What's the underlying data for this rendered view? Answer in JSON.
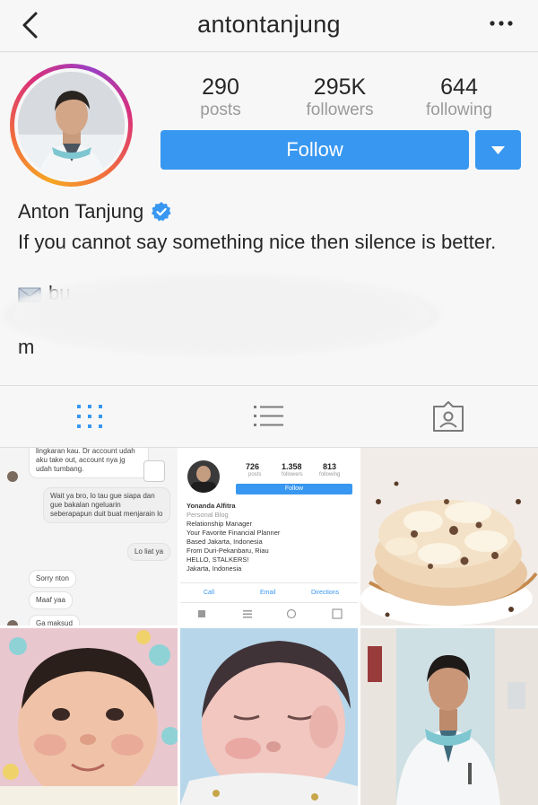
{
  "header": {
    "username": "antontanjung",
    "back_icon": "chevron-left-icon",
    "more_icon": "more-horizontal-icon"
  },
  "profile": {
    "stats": [
      {
        "value": "290",
        "label": "posts"
      },
      {
        "value": "295K",
        "label": "followers"
      },
      {
        "value": "644",
        "label": "following"
      }
    ],
    "follow_label": "Follow",
    "name": "Anton Tanjung",
    "verified_icon": "verified-badge-icon",
    "bio": "If you cannot say something nice then silence is better.",
    "bio_fragment_1": "bu",
    "bio_fragment_2": "m",
    "accent_color": "#3897f0"
  },
  "tabs": [
    {
      "icon": "grid-icon",
      "active": true
    },
    {
      "icon": "list-icon",
      "active": false
    },
    {
      "icon": "tagged-icon",
      "active": false
    }
  ],
  "posts": {
    "chat": {
      "messages": [
        {
          "from": "them",
          "text": "lingkaran kau. Dr account udah aku take out, account nya jg udah tumbang."
        },
        {
          "from": "me",
          "text": "Wait ya bro, lo tau gue siapa dan gue bakalan ngeluarin seberapapun duit buat menjarain lo"
        },
        {
          "from": "me",
          "text": "Lo liat ya"
        },
        {
          "from": "them",
          "text": "Sorry nton"
        },
        {
          "from": "them",
          "text": "Maaf yaa"
        },
        {
          "from": "them",
          "text": "Ga maksud"
        }
      ]
    },
    "mini_profile": {
      "stats": [
        {
          "value": "726",
          "label": "posts"
        },
        {
          "value": "1.358",
          "label": "followers"
        },
        {
          "value": "813",
          "label": "following"
        }
      ],
      "follow_label": "Follow",
      "name": "Yonanda Alfitra",
      "category": "Personal Blog",
      "lines": [
        "Relationship Manager",
        "Your Favorite Financial Planner",
        "Based Jakarta, Indonesia",
        "From Duri-Pekanbaru, Riau",
        "HELLO, STALKERS!",
        "Jakarta, Indonesia"
      ],
      "actions": [
        "Call",
        "Email",
        "Directions"
      ]
    }
  }
}
